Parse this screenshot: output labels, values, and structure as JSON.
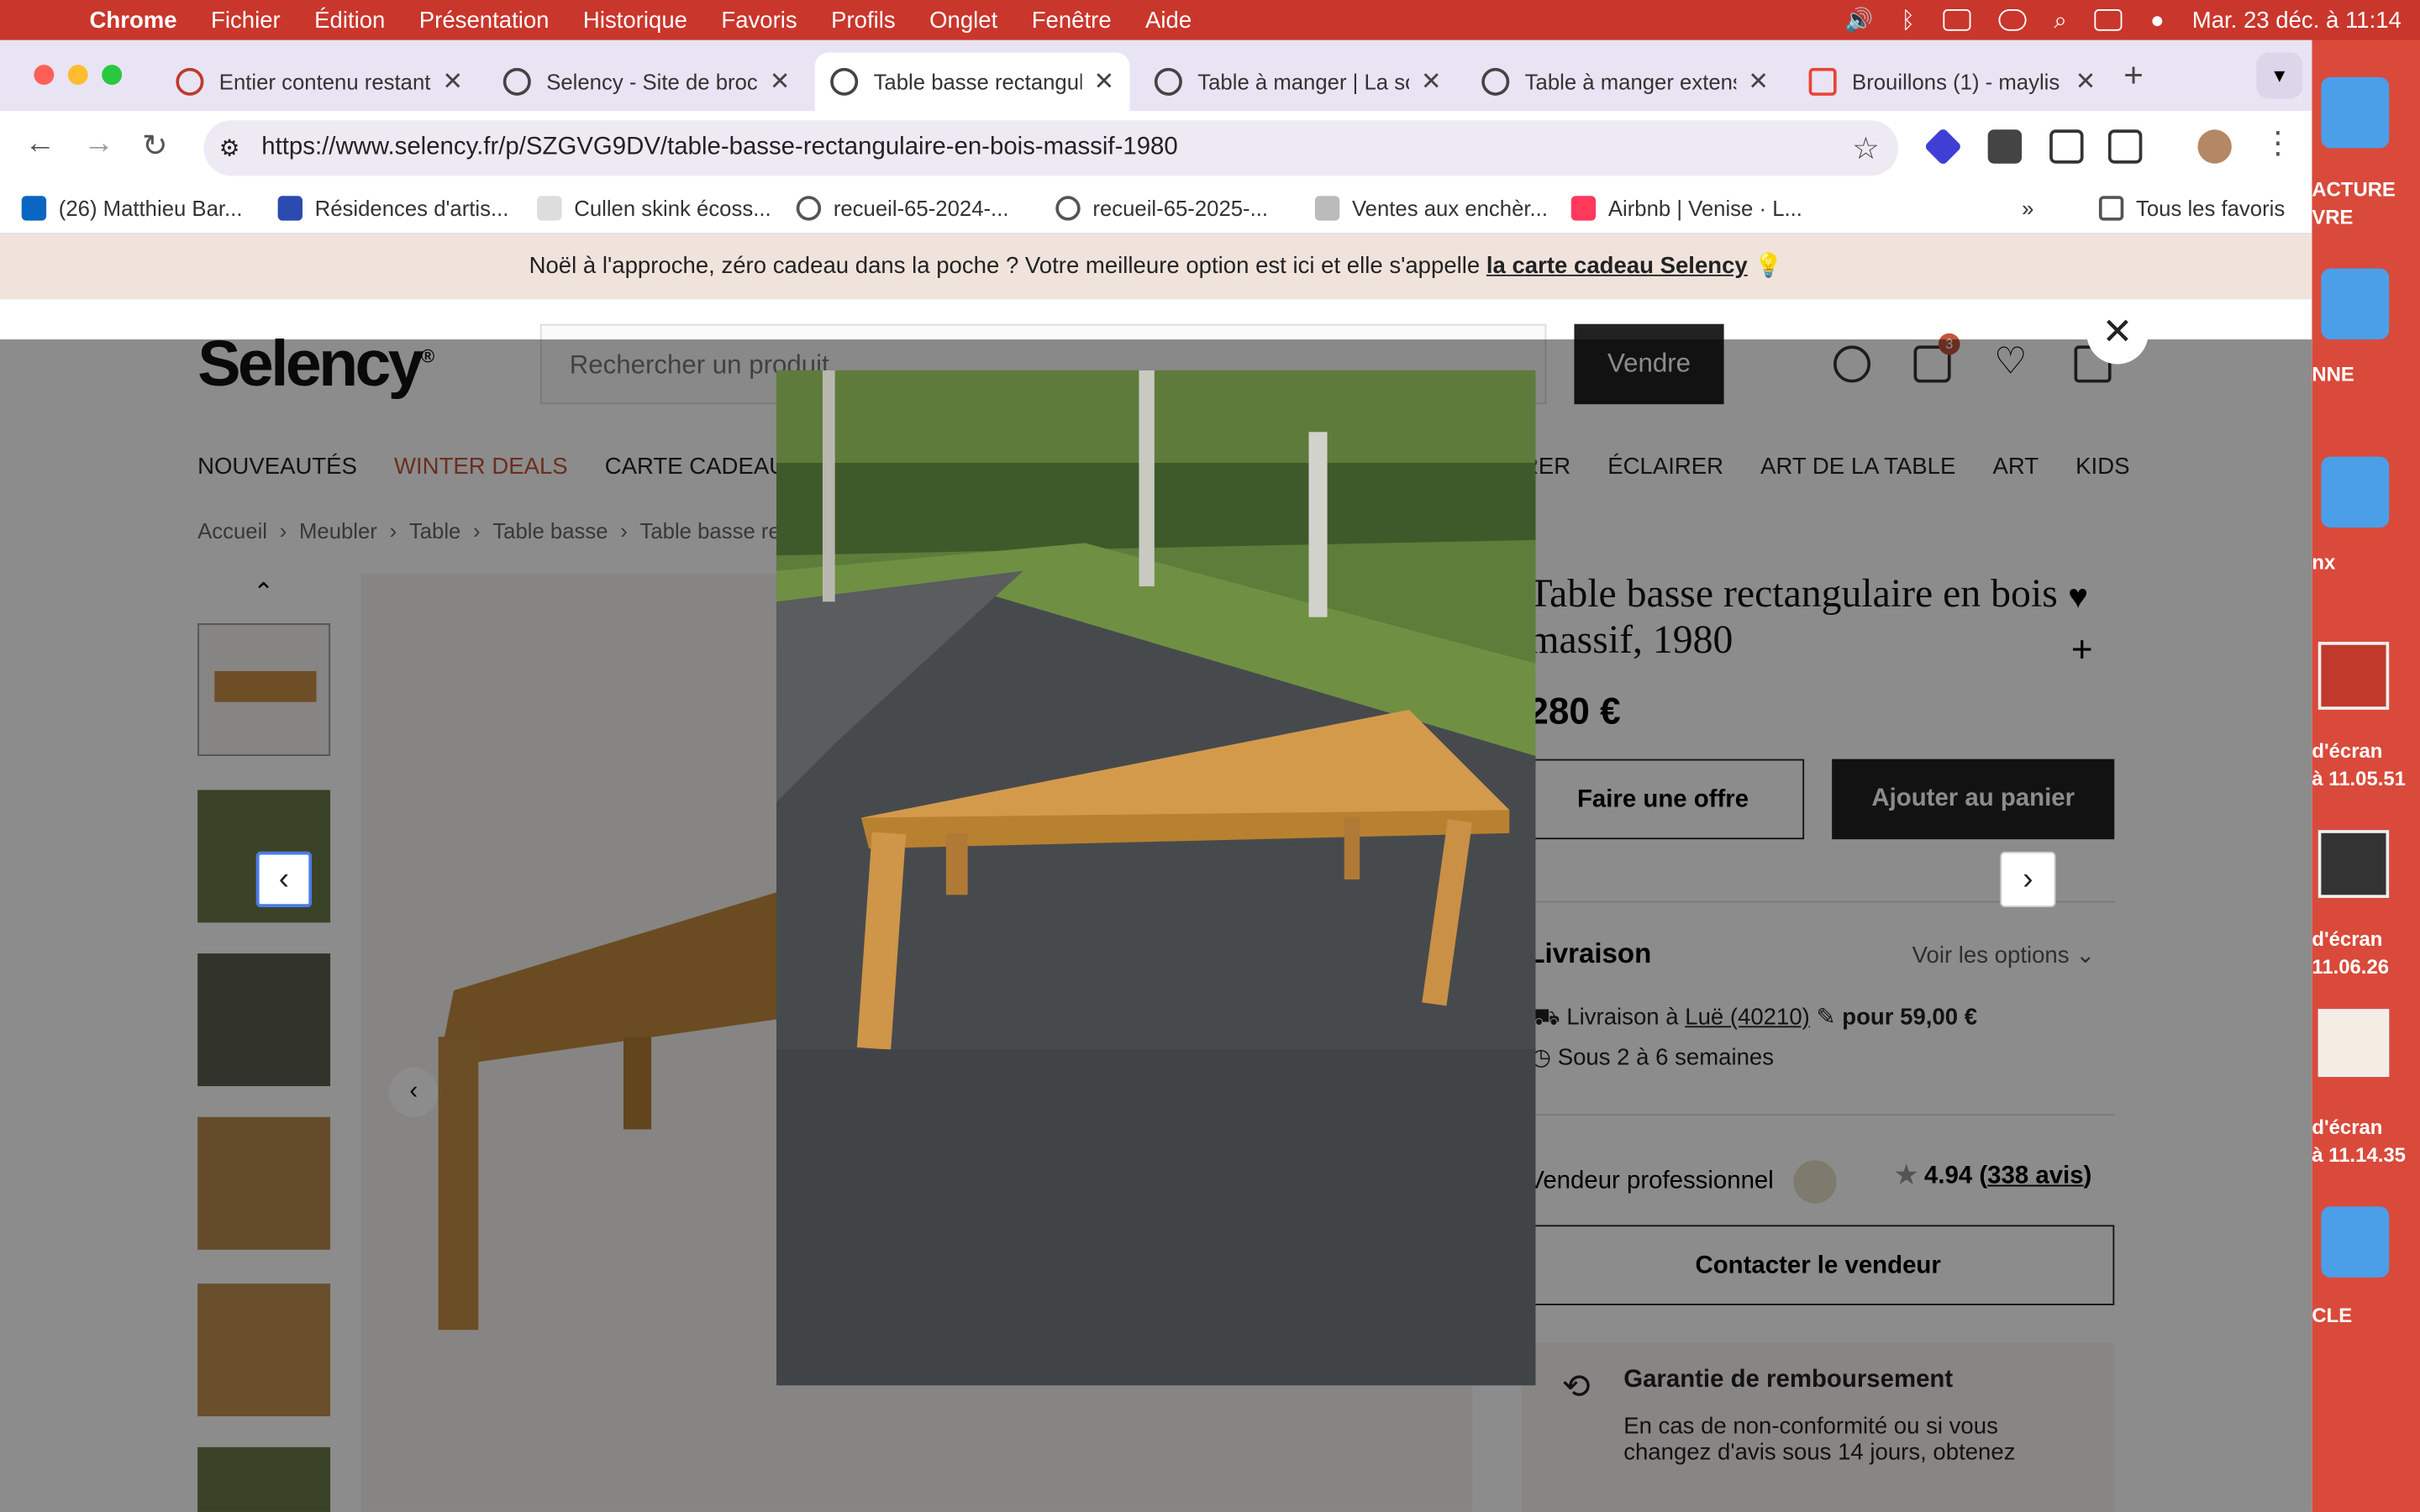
{
  "menubar": {
    "app": "Chrome",
    "items": [
      "Fichier",
      "Édition",
      "Présentation",
      "Historique",
      "Favoris",
      "Profils",
      "Onglet",
      "Fenêtre",
      "Aide"
    ],
    "datetime": "Mar. 23 déc. à 11:14"
  },
  "tabs": [
    {
      "title": "Entier contenu restant",
      "active": false
    },
    {
      "title": "Selency - Site de brocante",
      "active": false
    },
    {
      "title": "Table basse rectangulaire",
      "active": true
    },
    {
      "title": "Table à manger | La so",
      "active": false
    },
    {
      "title": "Table à manger extensible",
      "active": false
    },
    {
      "title": "Brouillons (1) - maylis",
      "active": false
    }
  ],
  "url": "https://www.selency.fr/p/SZGVG9DV/table-basse-rectangulaire-en-bois-massif-1980",
  "bookmarks": [
    "(26) Matthieu Bar...",
    "Résidences d'artis...",
    "Cullen skink écoss...",
    "recueil-65-2024-...",
    "recueil-65-2025-...",
    "Ventes aux enchèr...",
    "Airbnb | Venise · L...",
    "Tous les favoris"
  ],
  "desktop": {
    "labels": [
      "ACTURE\nVRE",
      "NNE",
      "nx",
      "d'écran\nà 11.05.51",
      "d'écran\n11.06.26",
      "d'écran\nà 11.14.35",
      "CLE"
    ]
  },
  "promo": {
    "text": "Noël à l'approche, zéro cadeau dans la poche ? Votre meilleure option est ici et elle s'appelle ",
    "link": "la carte cadeau Selency",
    "emoji": "💡"
  },
  "site": {
    "logo": "Selency",
    "search_placeholder": "Rechercher un produit",
    "sell": "Vendre",
    "cart_count": "3"
  },
  "nav": {
    "left": [
      "NOUVEAUTÉS",
      "WINTER DEALS",
      "CARTE CADEAU"
    ],
    "right": [
      "RER",
      "ÉCLAIRER",
      "ART DE LA TABLE",
      "ART",
      "KIDS"
    ]
  },
  "breadcrumbs": [
    "Accueil",
    "Meubler",
    "Table",
    "Table basse",
    "Table basse re"
  ],
  "product": {
    "title": "Table basse rectangulaire en bois massif, 1980",
    "price": "280 €",
    "offer": "Faire une offre",
    "add_cart": "Ajouter au panier"
  },
  "shipping": {
    "title": "Livraison",
    "options": "Voir les options",
    "line1_prefix": "Livraison à ",
    "line1_place": "Luë (40210)",
    "line1_suffix": " pour 59,00 €",
    "line2": "Sous 2 à 6 semaines"
  },
  "seller": {
    "label": "Vendeur professionnel",
    "rating": "4.94",
    "reviews": "338 avis",
    "contact": "Contacter le vendeur"
  },
  "guarantee": {
    "title": "Garantie de remboursement",
    "text": "En cas de non-conformité ou si vous changez d'avis sous 14 jours, obtenez"
  }
}
